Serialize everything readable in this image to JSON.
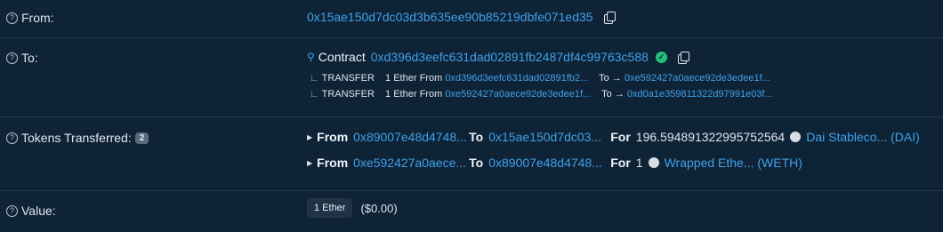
{
  "from": {
    "label": "From:",
    "address": "0x15ae150d7dc03d3b635ee90b85219dbfe071ed35"
  },
  "to": {
    "label": "To:",
    "contract_word": "Contract",
    "address": "0xd396d3eefc631dad02891fb2487df4c99763c588",
    "transfers": [
      {
        "type": "TRANSFER",
        "amount": "1 Ether",
        "from_word": "From",
        "from": "0xd396d3eefc631dad02891fb2...",
        "to_word": "To →",
        "to": "0xe592427a0aece92de3edee1f..."
      },
      {
        "type": "TRANSFER",
        "amount": "1 Ether",
        "from_word": "From",
        "from": "0xe592427a0aece92de3edee1f...",
        "to_word": "To →",
        "to": "0xd0a1e359811322d97991e03f..."
      }
    ]
  },
  "tokens": {
    "label": "Tokens Transferred:",
    "count": "2",
    "rows": [
      {
        "from_word": "From",
        "from": "0x89007e48d4748...",
        "to_word": "To",
        "to": "0x15ae150d7dc03...",
        "for_word": "For",
        "amount": "196.594891322995752564",
        "token": "Dai Stableco... (DAI)"
      },
      {
        "from_word": "From",
        "from": "0xe592427a0aece...",
        "to_word": "To",
        "to": "0x89007e48d4748...",
        "for_word": "For",
        "amount": "1",
        "token": "Wrapped Ethe... (WETH)"
      }
    ]
  },
  "value": {
    "label": "Value:",
    "amount": "1 Ether",
    "usd": "($0.00)"
  },
  "colors": {
    "background": "#0f2336",
    "link": "#3fa1ea",
    "verified": "#21c17a"
  }
}
